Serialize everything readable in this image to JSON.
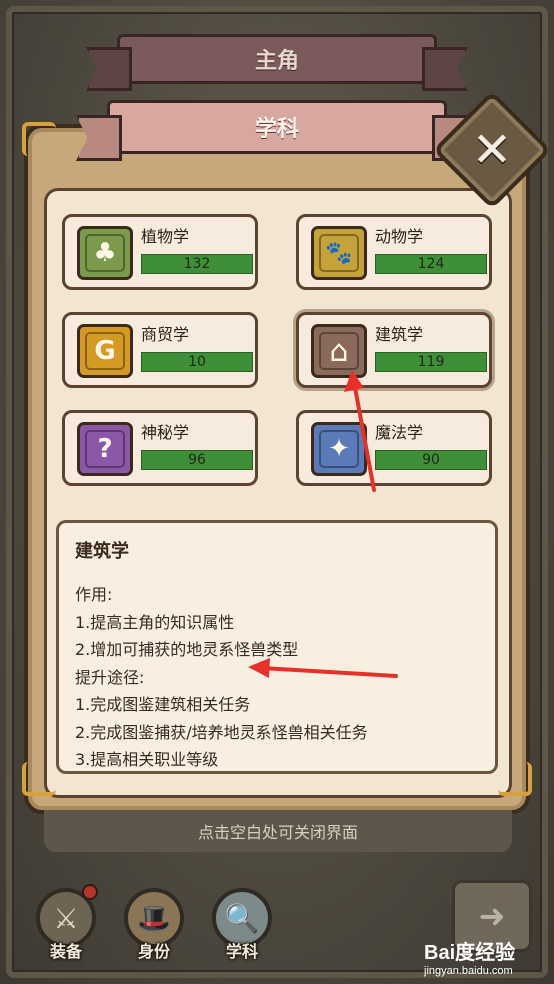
{
  "ribbons": {
    "top": "主角",
    "active": "学科"
  },
  "close": {
    "glyph": "✕"
  },
  "subjects": [
    {
      "name": "植物学",
      "value": "132",
      "icon": "leaf-icon",
      "icon_glyph": "♣",
      "color": "#7c9a4b"
    },
    {
      "name": "动物学",
      "value": "124",
      "icon": "paw-icon",
      "icon_glyph": "🐾",
      "color": "#c6a23a"
    },
    {
      "name": "商贸学",
      "value": "10",
      "icon": "money-bag-icon",
      "icon_glyph": "G",
      "color": "#d59a22"
    },
    {
      "name": "建筑学",
      "value": "119",
      "icon": "house-icon",
      "icon_glyph": "⌂",
      "color": "#8a6a5a"
    },
    {
      "name": "神秘学",
      "value": "96",
      "icon": "potion-icon",
      "icon_glyph": "?",
      "color": "#8b58a8"
    },
    {
      "name": "魔法学",
      "value": "90",
      "icon": "magic-book-icon",
      "icon_glyph": "✦",
      "color": "#5a7bb8"
    }
  ],
  "description": {
    "title": "建筑学",
    "lines": [
      "作用:",
      "1.提高主角的知识属性",
      "2.增加可捕获的地灵系怪兽类型",
      "提升途径:",
      "1.完成图鉴建筑相关任务",
      "2.完成图鉴捕获/培养地灵系怪兽相关任务",
      "3.提高相关职业等级"
    ]
  },
  "hint": "点击空白处可关闭界面",
  "nav": [
    {
      "label": "装备",
      "icon": "shield-sword-icon",
      "glyph": "⚔"
    },
    {
      "label": "身份",
      "icon": "hat-icon",
      "glyph": "🎩"
    },
    {
      "label": "学科",
      "icon": "magnifier-icon",
      "glyph": "🔍"
    }
  ],
  "next": {
    "glyph": "➜"
  },
  "watermark": {
    "brand": "Bai度经验",
    "url": "jingyan.baidu.com"
  },
  "colors": {
    "bar_green": "#3f8f39",
    "arrow_red": "#e8302a",
    "panel_tan": "#c7a87b"
  }
}
